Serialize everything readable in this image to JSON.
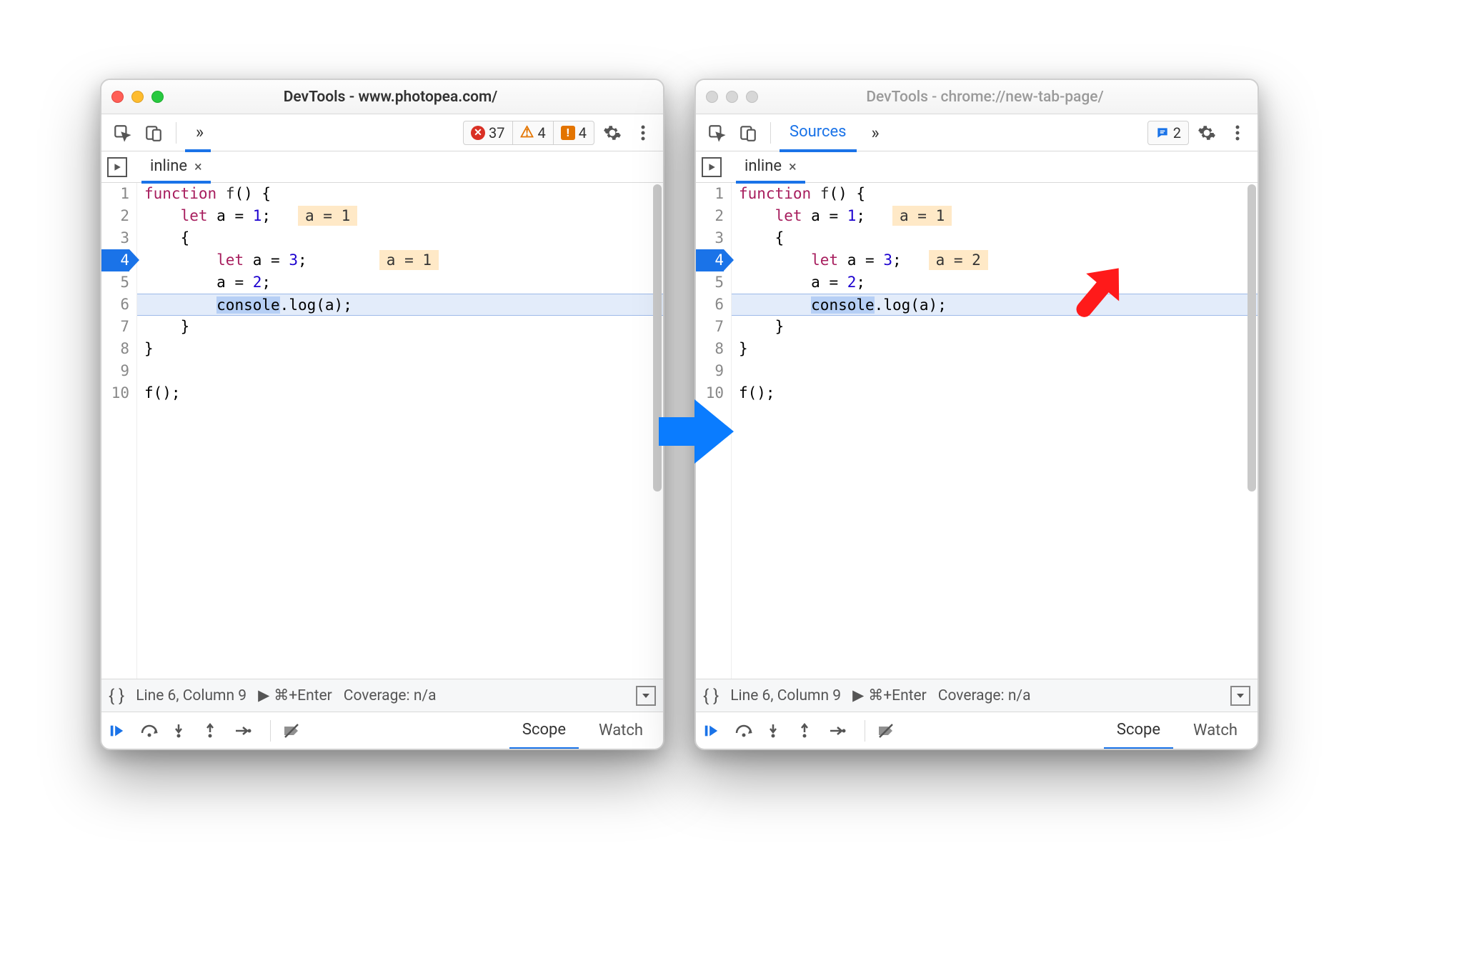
{
  "windows": {
    "left": {
      "title": "DevTools - www.photopea.com/",
      "active": true,
      "badges": {
        "errors": "37",
        "warnings": "4",
        "issues": "4"
      },
      "file_tab": "inline",
      "code": {
        "lines": [
          "1",
          "2",
          "3",
          "4",
          "5",
          "6",
          "7",
          "8",
          "9",
          "10"
        ],
        "inline_line2": "a = 1",
        "inline_line4": "a = 1",
        "tokens": {
          "function": "function",
          "f": "f",
          "let": "let",
          "a": "a",
          "n1": "1",
          "n2": "2",
          "n3": "3",
          "console": "console",
          "log": "log",
          "call": "f();"
        }
      },
      "status": {
        "pos": "Line 6, Column 9",
        "run": "⌘+Enter",
        "cov": "Coverage: n/a"
      },
      "panels": {
        "scope": "Scope",
        "watch": "Watch"
      }
    },
    "right": {
      "title": "DevTools - chrome://new-tab-page/",
      "active": false,
      "sources_tab": "Sources",
      "chat_count": "2",
      "file_tab": "inline",
      "code": {
        "lines": [
          "1",
          "2",
          "3",
          "4",
          "5",
          "6",
          "7",
          "8",
          "9",
          "10"
        ],
        "inline_line2": "a = 1",
        "inline_line4": "a = 2",
        "tokens": {
          "function": "function",
          "f": "f",
          "let": "let",
          "a": "a",
          "n1": "1",
          "n2": "2",
          "n3": "3",
          "console": "console",
          "log": "log",
          "call": "f();"
        }
      },
      "status": {
        "pos": "Line 6, Column 9",
        "run": "⌘+Enter",
        "cov": "Coverage: n/a"
      },
      "panels": {
        "scope": "Scope",
        "watch": "Watch"
      }
    }
  },
  "icons": {
    "play_tri": "▶",
    "cross": "×"
  }
}
